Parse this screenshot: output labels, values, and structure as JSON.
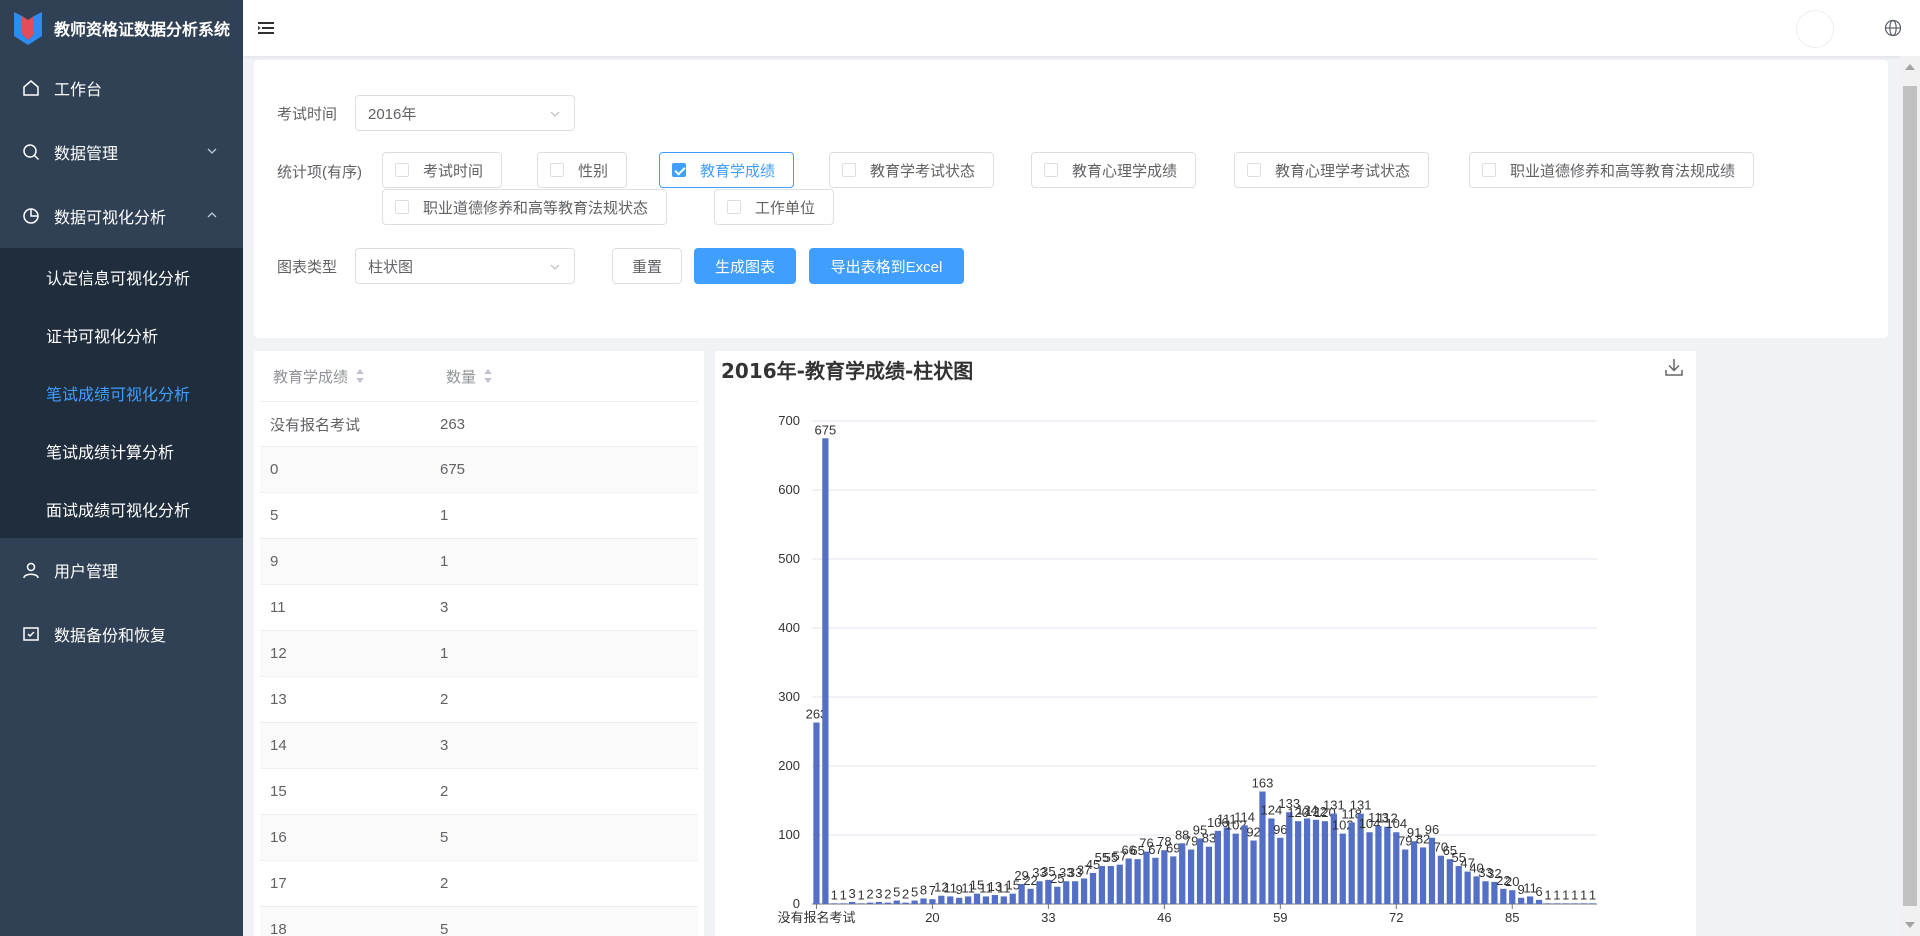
{
  "app": {
    "title": "教师资格证数据分析系统"
  },
  "sidebar": {
    "items": [
      {
        "label": "工作台"
      },
      {
        "label": "数据管理"
      },
      {
        "label": "数据可视化分析"
      },
      {
        "label": "用户管理"
      },
      {
        "label": "数据备份和恢复"
      }
    ],
    "sub": [
      {
        "label": "认定信息可视化分析"
      },
      {
        "label": "证书可视化分析"
      },
      {
        "label": "笔试成绩可视化分析"
      },
      {
        "label": "笔试成绩计算分析"
      },
      {
        "label": "面试成绩可视化分析"
      }
    ]
  },
  "filters": {
    "exam_time_label": "考试时间",
    "exam_time_value": "2016年",
    "stats_label": "统计项(有序)",
    "options": [
      {
        "label": "考试时间",
        "checked": false
      },
      {
        "label": "性别",
        "checked": false
      },
      {
        "label": "教育学成绩",
        "checked": true
      },
      {
        "label": "教育学考试状态",
        "checked": false
      },
      {
        "label": "教育心理学成绩",
        "checked": false
      },
      {
        "label": "教育心理学考试状态",
        "checked": false
      },
      {
        "label": "职业道德修养和高等教育法规成绩",
        "checked": false
      },
      {
        "label": "职业道德修养和高等教育法规状态",
        "checked": false
      },
      {
        "label": "工作单位",
        "checked": false
      }
    ],
    "chart_type_label": "图表类型",
    "chart_type_value": "柱状图",
    "reset_label": "重置",
    "generate_label": "生成图表",
    "export_label": "导出表格到Excel"
  },
  "table": {
    "headers": [
      "教育学成绩",
      "数量"
    ],
    "rows": [
      [
        "没有报名考试",
        "263"
      ],
      [
        "0",
        "675"
      ],
      [
        "5",
        "1"
      ],
      [
        "9",
        "1"
      ],
      [
        "11",
        "3"
      ],
      [
        "12",
        "1"
      ],
      [
        "13",
        "2"
      ],
      [
        "14",
        "3"
      ],
      [
        "15",
        "2"
      ],
      [
        "16",
        "5"
      ],
      [
        "17",
        "2"
      ],
      [
        "18",
        "5"
      ]
    ]
  },
  "chart_data": {
    "type": "bar",
    "title": "2016年-教育学成绩-柱状图",
    "ylim": [
      0,
      700
    ],
    "yticks": [
      0,
      100,
      200,
      300,
      400,
      500,
      600,
      700
    ],
    "xtick_labels": [
      "没有报名考试",
      "20",
      "33",
      "46",
      "59",
      "72",
      "85"
    ],
    "categories": [
      "没有报名考试",
      "0",
      "5",
      "9",
      "11",
      "12",
      "13",
      "14",
      "15",
      "16",
      "17",
      "18",
      "19",
      "20",
      "21",
      "22",
      "23",
      "24",
      "25",
      "26",
      "27",
      "28",
      "29",
      "30",
      "31",
      "32",
      "33",
      "34",
      "35",
      "36",
      "37",
      "38",
      "39",
      "40",
      "41",
      "42",
      "43",
      "44",
      "45",
      "46",
      "47",
      "48",
      "49",
      "50",
      "51",
      "52",
      "53",
      "54",
      "55",
      "56",
      "57",
      "58",
      "59",
      "60",
      "61",
      "62",
      "63",
      "64",
      "65",
      "66",
      "67",
      "68",
      "69",
      "70",
      "71",
      "72",
      "73",
      "74",
      "75",
      "76",
      "77",
      "78",
      "79",
      "80",
      "81",
      "82",
      "83",
      "84",
      "85",
      "86",
      "87",
      "88",
      "89",
      "90",
      "91",
      "92",
      "93",
      "94"
    ],
    "values": [
      263,
      675,
      1,
      1,
      3,
      1,
      2,
      3,
      2,
      5,
      2,
      5,
      8,
      7,
      12,
      11,
      9,
      11,
      15,
      11,
      13,
      11,
      15,
      29,
      22,
      33,
      35,
      25,
      33,
      33,
      37,
      45,
      55,
      55,
      57,
      66,
      65,
      76,
      67,
      78,
      69,
      88,
      79,
      95,
      83,
      106,
      111,
      102,
      114,
      92,
      163,
      124,
      96,
      133,
      120,
      124,
      122,
      120,
      131,
      102,
      118,
      131,
      104,
      113,
      112,
      104,
      79,
      91,
      82,
      96,
      70,
      65,
      55,
      47,
      40,
      33,
      32,
      22,
      20,
      9,
      11,
      6,
      1,
      1,
      1,
      1,
      1,
      1
    ],
    "color": "#5470c6"
  }
}
